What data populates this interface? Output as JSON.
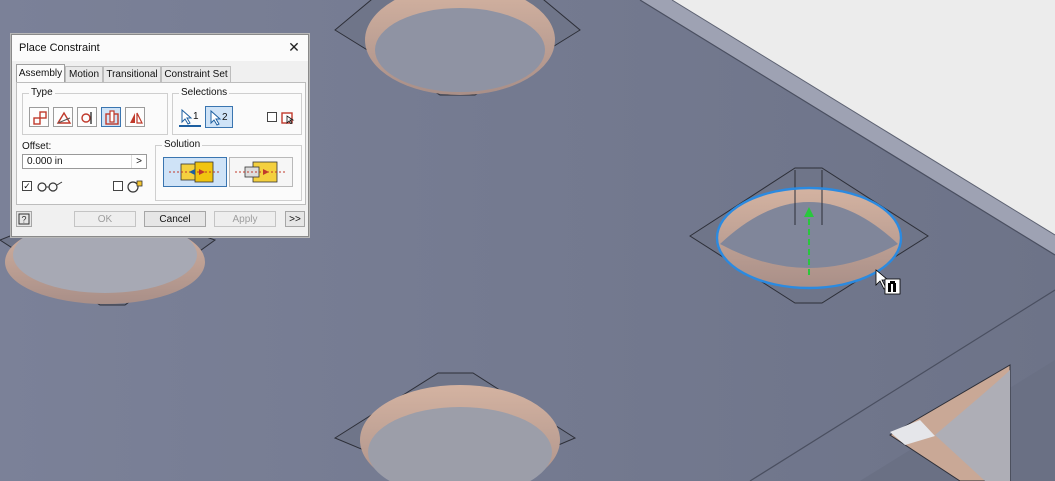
{
  "dialog": {
    "title": "Place Constraint",
    "close_glyph": "✕",
    "tabs": [
      {
        "label": "Assembly",
        "active": true
      },
      {
        "label": "Motion",
        "active": false
      },
      {
        "label": "Transitional",
        "active": false
      },
      {
        "label": "Constraint Set",
        "active": false
      }
    ],
    "type_group": {
      "label": "Type",
      "buttons": [
        {
          "icon": "mate-constraint-icon",
          "active": false
        },
        {
          "icon": "angle-constraint-icon",
          "active": false
        },
        {
          "icon": "tangent-constraint-icon",
          "active": false
        },
        {
          "icon": "insert-constraint-icon",
          "active": true
        },
        {
          "icon": "symmetry-constraint-icon",
          "active": false
        }
      ]
    },
    "selections_group": {
      "label": "Selections",
      "sel1_number": "1",
      "sel2_number": "2",
      "sel2_active": true,
      "pick_part_first_icon": "pick-part-first-icon",
      "pick_part_first_checked": false
    },
    "offset": {
      "label": "Offset:",
      "value": "0.000 in",
      "arrow": ">"
    },
    "show_preview_checked": true,
    "show_preview_icon": "glasses-preview-icon",
    "predict_offset_checked": false,
    "predict_offset_icon": "predict-offset-icon",
    "solution_group": {
      "label": "Solution",
      "options": [
        {
          "icon": "opposed-solution-icon",
          "active": true
        },
        {
          "icon": "aligned-solution-icon",
          "active": false
        }
      ]
    },
    "footer": {
      "help_icon": "help-icon",
      "ok_label": "OK",
      "cancel_label": "Cancel",
      "apply_label": "Apply",
      "more_label": ">>"
    }
  },
  "colors": {
    "model_face": "#7a8096",
    "hole_rim": "#c9a896",
    "selection_highlight": "#2b8ae0",
    "axis_preview": "#28c83c",
    "dialog_bg": "#f0f0f0",
    "active_button": "#cfe3f7"
  },
  "cursor_icon": "insert-constraint-cursor-icon"
}
